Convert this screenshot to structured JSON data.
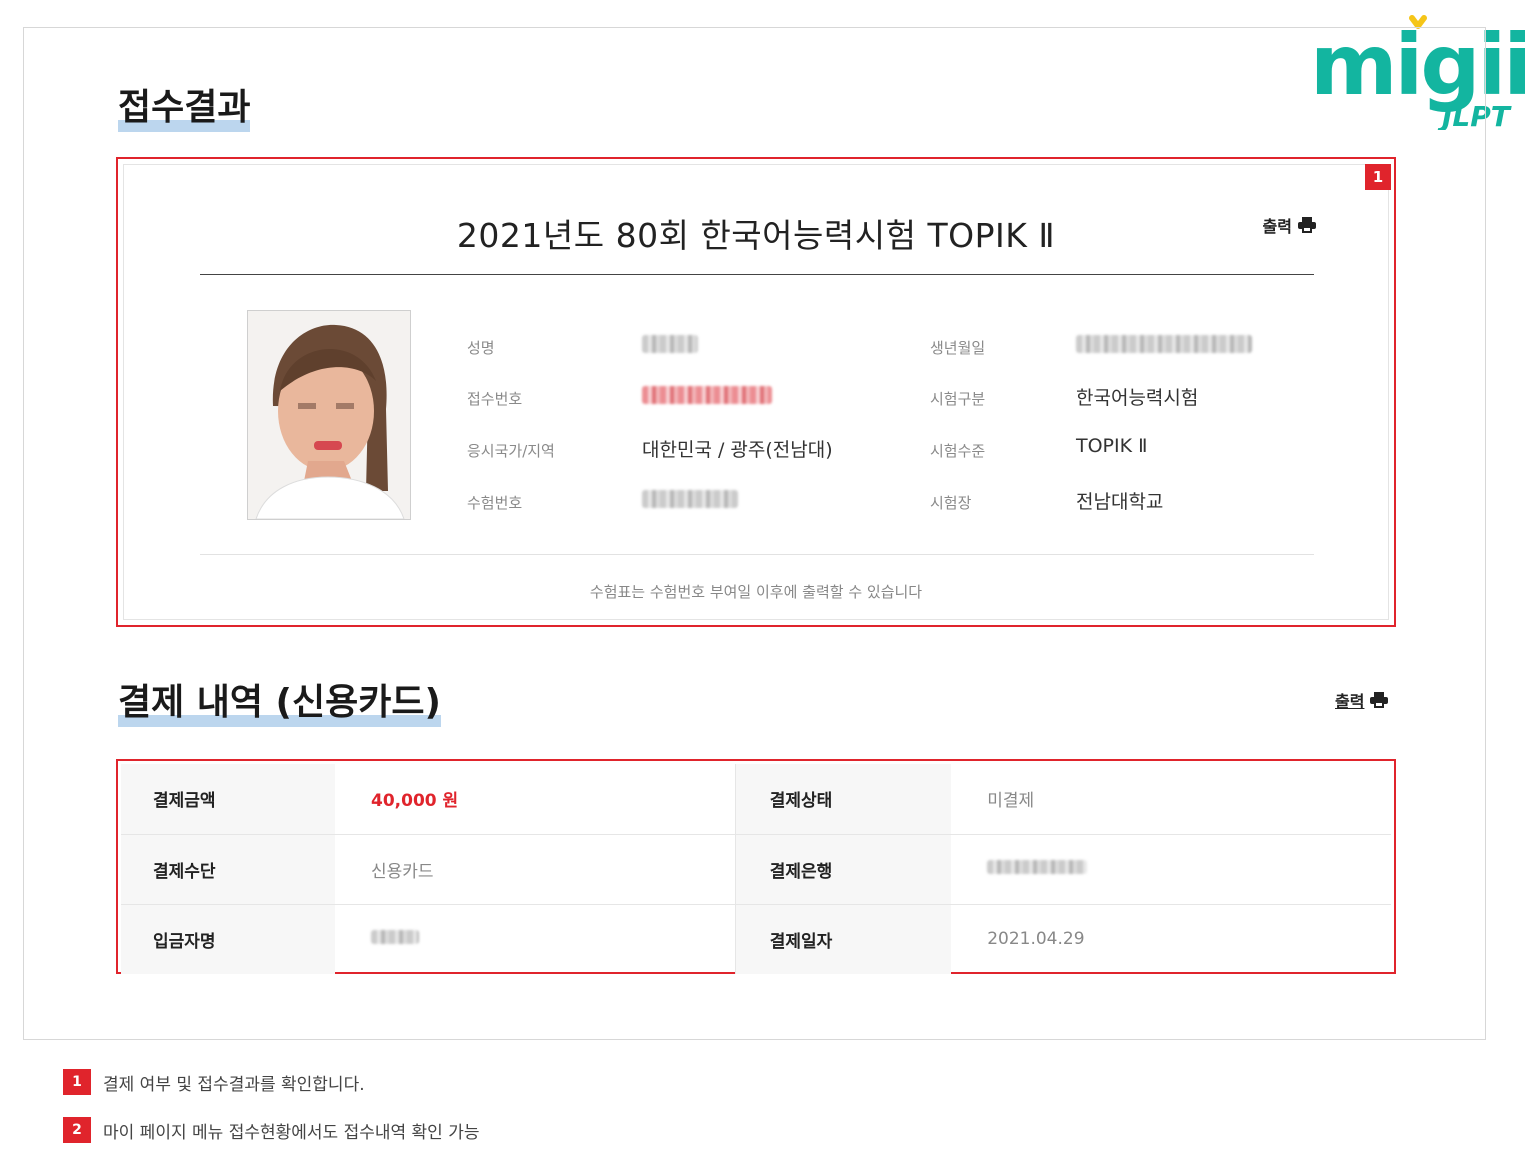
{
  "brand": {
    "logo_text": "migii",
    "logo_sub": "JLPT",
    "colors": {
      "teal": "#13b5a0",
      "yellow": "#f5c518",
      "red": "#e0242c",
      "highlight": "#bcd6ee"
    }
  },
  "registration": {
    "section_title": "접수결과",
    "badge": "1",
    "exam_title": "2021년도 80회 한국어능력시험 TOPIK Ⅱ",
    "print_label": "출력",
    "fields": {
      "name_label": "성명",
      "birth_label": "생년월일",
      "reg_no_label": "접수번호",
      "exam_type_label": "시험구분",
      "exam_type_value": "한국어능력시험",
      "region_label": "응시국가/지역",
      "region_value": "대한민국 / 광주(전남대)",
      "level_label": "시험수준",
      "level_value": "TOPIK Ⅱ",
      "exam_no_label": "수험번호",
      "venue_label": "시험장",
      "venue_value": "전남대학교"
    },
    "notice": "수험표는 수험번호 부여일 이후에 출력할 수 있습니다"
  },
  "payment": {
    "section_title": "결제 내역 (신용카드)",
    "print_label": "출력",
    "rows": [
      {
        "label1": "결제금액",
        "value1": "40,000 원",
        "label2": "결제상태",
        "value2": "미결제"
      },
      {
        "label1": "결제수단",
        "value1": "신용카드",
        "label2": "결제은행",
        "value2": ""
      },
      {
        "label1": "입금자명",
        "value1": "",
        "label2": "결제일자",
        "value2": "2021.04.29"
      }
    ]
  },
  "notes": [
    {
      "num": "1",
      "text": "결제 여부 및 접수결과를 확인합니다."
    },
    {
      "num": "2",
      "text": "마이 페이지 메뉴 접수현황에서도 접수내역 확인 가능"
    }
  ]
}
